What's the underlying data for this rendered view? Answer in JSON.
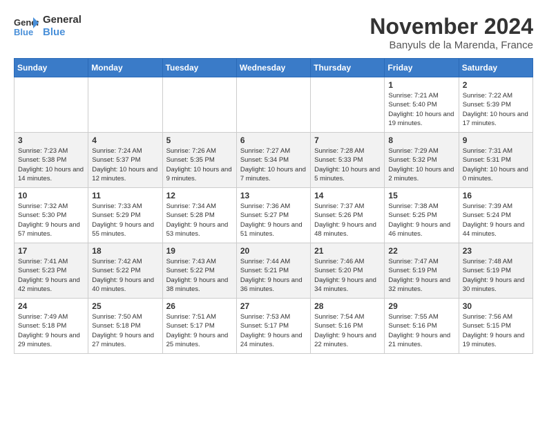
{
  "header": {
    "logo_line1": "General",
    "logo_line2": "Blue",
    "month": "November 2024",
    "location": "Banyuls de la Marenda, France"
  },
  "days_of_week": [
    "Sunday",
    "Monday",
    "Tuesday",
    "Wednesday",
    "Thursday",
    "Friday",
    "Saturday"
  ],
  "weeks": [
    [
      {
        "day": "",
        "info": ""
      },
      {
        "day": "",
        "info": ""
      },
      {
        "day": "",
        "info": ""
      },
      {
        "day": "",
        "info": ""
      },
      {
        "day": "",
        "info": ""
      },
      {
        "day": "1",
        "info": "Sunrise: 7:21 AM\nSunset: 5:40 PM\nDaylight: 10 hours and 19 minutes."
      },
      {
        "day": "2",
        "info": "Sunrise: 7:22 AM\nSunset: 5:39 PM\nDaylight: 10 hours and 17 minutes."
      }
    ],
    [
      {
        "day": "3",
        "info": "Sunrise: 7:23 AM\nSunset: 5:38 PM\nDaylight: 10 hours and 14 minutes."
      },
      {
        "day": "4",
        "info": "Sunrise: 7:24 AM\nSunset: 5:37 PM\nDaylight: 10 hours and 12 minutes."
      },
      {
        "day": "5",
        "info": "Sunrise: 7:26 AM\nSunset: 5:35 PM\nDaylight: 10 hours and 9 minutes."
      },
      {
        "day": "6",
        "info": "Sunrise: 7:27 AM\nSunset: 5:34 PM\nDaylight: 10 hours and 7 minutes."
      },
      {
        "day": "7",
        "info": "Sunrise: 7:28 AM\nSunset: 5:33 PM\nDaylight: 10 hours and 5 minutes."
      },
      {
        "day": "8",
        "info": "Sunrise: 7:29 AM\nSunset: 5:32 PM\nDaylight: 10 hours and 2 minutes."
      },
      {
        "day": "9",
        "info": "Sunrise: 7:31 AM\nSunset: 5:31 PM\nDaylight: 10 hours and 0 minutes."
      }
    ],
    [
      {
        "day": "10",
        "info": "Sunrise: 7:32 AM\nSunset: 5:30 PM\nDaylight: 9 hours and 57 minutes."
      },
      {
        "day": "11",
        "info": "Sunrise: 7:33 AM\nSunset: 5:29 PM\nDaylight: 9 hours and 55 minutes."
      },
      {
        "day": "12",
        "info": "Sunrise: 7:34 AM\nSunset: 5:28 PM\nDaylight: 9 hours and 53 minutes."
      },
      {
        "day": "13",
        "info": "Sunrise: 7:36 AM\nSunset: 5:27 PM\nDaylight: 9 hours and 51 minutes."
      },
      {
        "day": "14",
        "info": "Sunrise: 7:37 AM\nSunset: 5:26 PM\nDaylight: 9 hours and 48 minutes."
      },
      {
        "day": "15",
        "info": "Sunrise: 7:38 AM\nSunset: 5:25 PM\nDaylight: 9 hours and 46 minutes."
      },
      {
        "day": "16",
        "info": "Sunrise: 7:39 AM\nSunset: 5:24 PM\nDaylight: 9 hours and 44 minutes."
      }
    ],
    [
      {
        "day": "17",
        "info": "Sunrise: 7:41 AM\nSunset: 5:23 PM\nDaylight: 9 hours and 42 minutes."
      },
      {
        "day": "18",
        "info": "Sunrise: 7:42 AM\nSunset: 5:22 PM\nDaylight: 9 hours and 40 minutes."
      },
      {
        "day": "19",
        "info": "Sunrise: 7:43 AM\nSunset: 5:22 PM\nDaylight: 9 hours and 38 minutes."
      },
      {
        "day": "20",
        "info": "Sunrise: 7:44 AM\nSunset: 5:21 PM\nDaylight: 9 hours and 36 minutes."
      },
      {
        "day": "21",
        "info": "Sunrise: 7:46 AM\nSunset: 5:20 PM\nDaylight: 9 hours and 34 minutes."
      },
      {
        "day": "22",
        "info": "Sunrise: 7:47 AM\nSunset: 5:19 PM\nDaylight: 9 hours and 32 minutes."
      },
      {
        "day": "23",
        "info": "Sunrise: 7:48 AM\nSunset: 5:19 PM\nDaylight: 9 hours and 30 minutes."
      }
    ],
    [
      {
        "day": "24",
        "info": "Sunrise: 7:49 AM\nSunset: 5:18 PM\nDaylight: 9 hours and 29 minutes."
      },
      {
        "day": "25",
        "info": "Sunrise: 7:50 AM\nSunset: 5:18 PM\nDaylight: 9 hours and 27 minutes."
      },
      {
        "day": "26",
        "info": "Sunrise: 7:51 AM\nSunset: 5:17 PM\nDaylight: 9 hours and 25 minutes."
      },
      {
        "day": "27",
        "info": "Sunrise: 7:53 AM\nSunset: 5:17 PM\nDaylight: 9 hours and 24 minutes."
      },
      {
        "day": "28",
        "info": "Sunrise: 7:54 AM\nSunset: 5:16 PM\nDaylight: 9 hours and 22 minutes."
      },
      {
        "day": "29",
        "info": "Sunrise: 7:55 AM\nSunset: 5:16 PM\nDaylight: 9 hours and 21 minutes."
      },
      {
        "day": "30",
        "info": "Sunrise: 7:56 AM\nSunset: 5:15 PM\nDaylight: 9 hours and 19 minutes."
      }
    ]
  ]
}
